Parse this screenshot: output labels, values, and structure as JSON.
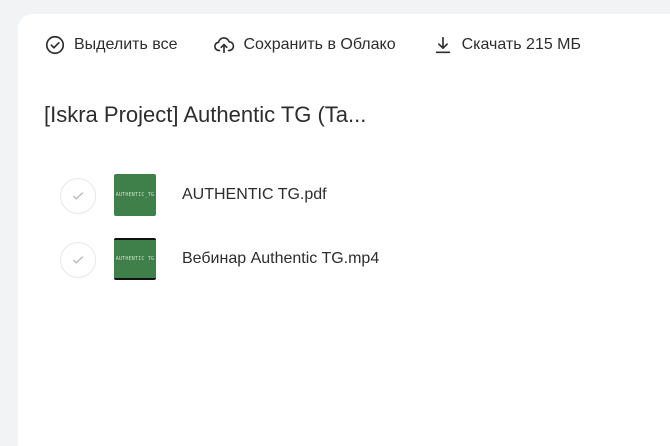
{
  "toolbar": {
    "select_all": "Выделить все",
    "save_to_cloud": "Сохранить в Облако",
    "download": "Скачать 215 МБ"
  },
  "folder": {
    "title": "[Iskra Project] Authentic TG (Ta..."
  },
  "files": [
    {
      "name": "AUTHENTIC TG.pdf",
      "thumb_text": "AUTHENTIC_TG",
      "icon": "pdf-thumbnail"
    },
    {
      "name": "Вебинар Authentic TG.mp4",
      "thumb_text": "AUTHENTIC TG",
      "icon": "video-thumbnail"
    }
  ],
  "colors": {
    "background": "#f2f3f5",
    "panel": "#ffffff",
    "text": "#2c2d2e",
    "thumb_green": "#3f7f4a"
  }
}
